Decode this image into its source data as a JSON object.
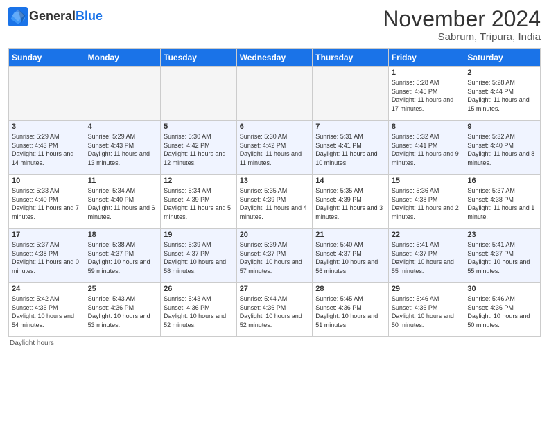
{
  "header": {
    "logo_line1": "General",
    "logo_line2": "Blue",
    "month": "November 2024",
    "location": "Sabrum, Tripura, India"
  },
  "columns": [
    "Sunday",
    "Monday",
    "Tuesday",
    "Wednesday",
    "Thursday",
    "Friday",
    "Saturday"
  ],
  "weeks": [
    [
      {
        "day": "",
        "info": ""
      },
      {
        "day": "",
        "info": ""
      },
      {
        "day": "",
        "info": ""
      },
      {
        "day": "",
        "info": ""
      },
      {
        "day": "",
        "info": ""
      },
      {
        "day": "1",
        "info": "Sunrise: 5:28 AM\nSunset: 4:45 PM\nDaylight: 11 hours and 17 minutes."
      },
      {
        "day": "2",
        "info": "Sunrise: 5:28 AM\nSunset: 4:44 PM\nDaylight: 11 hours and 15 minutes."
      }
    ],
    [
      {
        "day": "3",
        "info": "Sunrise: 5:29 AM\nSunset: 4:43 PM\nDaylight: 11 hours and 14 minutes."
      },
      {
        "day": "4",
        "info": "Sunrise: 5:29 AM\nSunset: 4:43 PM\nDaylight: 11 hours and 13 minutes."
      },
      {
        "day": "5",
        "info": "Sunrise: 5:30 AM\nSunset: 4:42 PM\nDaylight: 11 hours and 12 minutes."
      },
      {
        "day": "6",
        "info": "Sunrise: 5:30 AM\nSunset: 4:42 PM\nDaylight: 11 hours and 11 minutes."
      },
      {
        "day": "7",
        "info": "Sunrise: 5:31 AM\nSunset: 4:41 PM\nDaylight: 11 hours and 10 minutes."
      },
      {
        "day": "8",
        "info": "Sunrise: 5:32 AM\nSunset: 4:41 PM\nDaylight: 11 hours and 9 minutes."
      },
      {
        "day": "9",
        "info": "Sunrise: 5:32 AM\nSunset: 4:40 PM\nDaylight: 11 hours and 8 minutes."
      }
    ],
    [
      {
        "day": "10",
        "info": "Sunrise: 5:33 AM\nSunset: 4:40 PM\nDaylight: 11 hours and 7 minutes."
      },
      {
        "day": "11",
        "info": "Sunrise: 5:34 AM\nSunset: 4:40 PM\nDaylight: 11 hours and 6 minutes."
      },
      {
        "day": "12",
        "info": "Sunrise: 5:34 AM\nSunset: 4:39 PM\nDaylight: 11 hours and 5 minutes."
      },
      {
        "day": "13",
        "info": "Sunrise: 5:35 AM\nSunset: 4:39 PM\nDaylight: 11 hours and 4 minutes."
      },
      {
        "day": "14",
        "info": "Sunrise: 5:35 AM\nSunset: 4:39 PM\nDaylight: 11 hours and 3 minutes."
      },
      {
        "day": "15",
        "info": "Sunrise: 5:36 AM\nSunset: 4:38 PM\nDaylight: 11 hours and 2 minutes."
      },
      {
        "day": "16",
        "info": "Sunrise: 5:37 AM\nSunset: 4:38 PM\nDaylight: 11 hours and 1 minute."
      }
    ],
    [
      {
        "day": "17",
        "info": "Sunrise: 5:37 AM\nSunset: 4:38 PM\nDaylight: 11 hours and 0 minutes."
      },
      {
        "day": "18",
        "info": "Sunrise: 5:38 AM\nSunset: 4:37 PM\nDaylight: 10 hours and 59 minutes."
      },
      {
        "day": "19",
        "info": "Sunrise: 5:39 AM\nSunset: 4:37 PM\nDaylight: 10 hours and 58 minutes."
      },
      {
        "day": "20",
        "info": "Sunrise: 5:39 AM\nSunset: 4:37 PM\nDaylight: 10 hours and 57 minutes."
      },
      {
        "day": "21",
        "info": "Sunrise: 5:40 AM\nSunset: 4:37 PM\nDaylight: 10 hours and 56 minutes."
      },
      {
        "day": "22",
        "info": "Sunrise: 5:41 AM\nSunset: 4:37 PM\nDaylight: 10 hours and 55 minutes."
      },
      {
        "day": "23",
        "info": "Sunrise: 5:41 AM\nSunset: 4:37 PM\nDaylight: 10 hours and 55 minutes."
      }
    ],
    [
      {
        "day": "24",
        "info": "Sunrise: 5:42 AM\nSunset: 4:36 PM\nDaylight: 10 hours and 54 minutes."
      },
      {
        "day": "25",
        "info": "Sunrise: 5:43 AM\nSunset: 4:36 PM\nDaylight: 10 hours and 53 minutes."
      },
      {
        "day": "26",
        "info": "Sunrise: 5:43 AM\nSunset: 4:36 PM\nDaylight: 10 hours and 52 minutes."
      },
      {
        "day": "27",
        "info": "Sunrise: 5:44 AM\nSunset: 4:36 PM\nDaylight: 10 hours and 52 minutes."
      },
      {
        "day": "28",
        "info": "Sunrise: 5:45 AM\nSunset: 4:36 PM\nDaylight: 10 hours and 51 minutes."
      },
      {
        "day": "29",
        "info": "Sunrise: 5:46 AM\nSunset: 4:36 PM\nDaylight: 10 hours and 50 minutes."
      },
      {
        "day": "30",
        "info": "Sunrise: 5:46 AM\nSunset: 4:36 PM\nDaylight: 10 hours and 50 minutes."
      }
    ]
  ],
  "footer": "Daylight hours"
}
